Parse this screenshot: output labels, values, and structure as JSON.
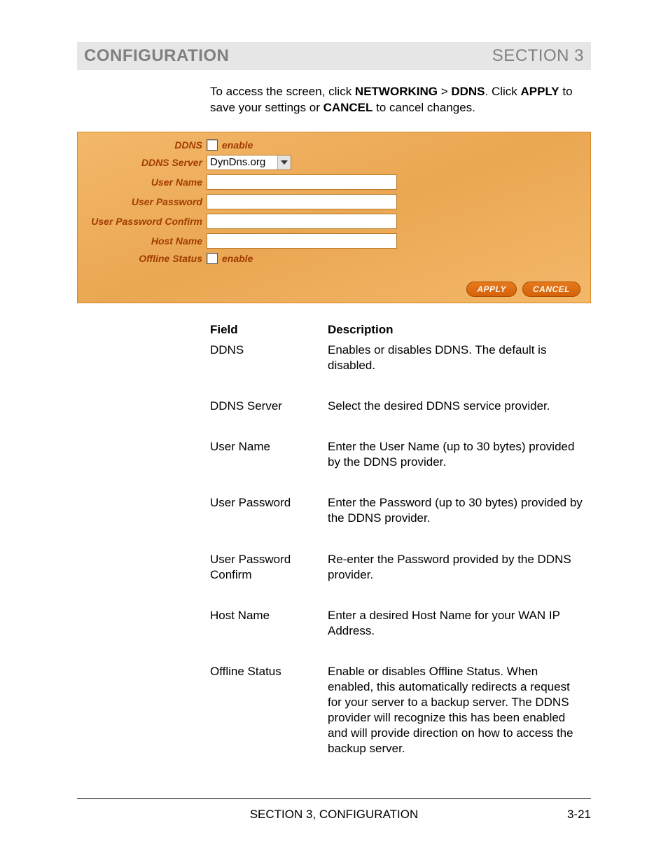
{
  "header": {
    "left": "CONFIGURATION",
    "right": "SECTION 3"
  },
  "intro": {
    "p1a": "To access the screen, click ",
    "b1": "NETWORKING",
    "sep": " > ",
    "b2": "DDNS",
    "p1b": ". Click ",
    "b3": "APPLY",
    "p1c": " to save your settings or ",
    "b4": "CANCEL",
    "p1d": " to cancel changes."
  },
  "form": {
    "labels": {
      "ddns": "DDNS",
      "server": "DDNS Server",
      "user": "User Name",
      "pass": "User Password",
      "passc": "User Password Confirm",
      "host": "Host Name",
      "offline": "Offline Status"
    },
    "enable_text": "enable",
    "server_value": "DynDns.org",
    "user_value": "",
    "pass_value": "",
    "passc_value": "",
    "host_value": "",
    "buttons": {
      "apply": "APPLY",
      "cancel": "CANCEL"
    }
  },
  "table": {
    "head_field": "Field",
    "head_desc": "Description",
    "rows": [
      {
        "field": "DDNS",
        "desc": "Enables or disables DDNS. The default is disabled."
      },
      {
        "field": "DDNS Server",
        "desc": "Select the desired DDNS service provider."
      },
      {
        "field": "User Name",
        "desc": "Enter the User Name (up to 30 bytes) provided by the DDNS provider."
      },
      {
        "field": "User Password",
        "desc": "Enter the Password (up to 30 bytes) provided by the DDNS provider."
      },
      {
        "field": "User Password Confirm",
        "desc": "Re-enter the Password provided by the DDNS provider."
      },
      {
        "field": "Host Name",
        "desc": "Enter a desired Host Name for your WAN IP Address."
      },
      {
        "field": "Offline Status",
        "desc": "Enable or disables Offline Status. When enabled, this automatically redirects a request for your server to a backup server. The DDNS provider will recognize this has been enabled and will provide direction on how to access the backup server."
      }
    ]
  },
  "footer": {
    "center": "SECTION 3, CONFIGURATION",
    "page": "3-21"
  }
}
